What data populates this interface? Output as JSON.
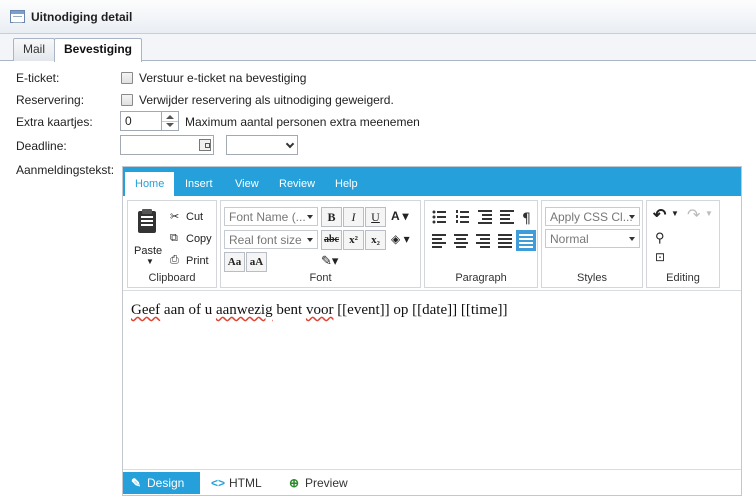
{
  "window": {
    "title": "Uitnodiging detail",
    "icon": "table-icon"
  },
  "tabs": [
    {
      "label": "Mail"
    },
    {
      "label": "Bevestiging"
    }
  ],
  "form": {
    "eticket": {
      "label": "E-ticket:",
      "checkbox_label": "Verstuur e-ticket na bevestiging",
      "checked": false
    },
    "reservering": {
      "label": "Reservering:",
      "checkbox_label": "Verwijder reservering als uitnodiging geweigerd.",
      "checked": false
    },
    "extra": {
      "label": "Extra kaartjes:",
      "value": "0",
      "hint": "Maximum aantal personen extra meenemen"
    },
    "deadline": {
      "label": "Deadline:",
      "date_value": "",
      "time_value": ""
    },
    "aanmelding": {
      "label": "Aanmeldingstekst:"
    }
  },
  "editor": {
    "ribbon_tabs": [
      "Home",
      "Insert",
      "View",
      "Review",
      "Help"
    ],
    "active_tab": "Home",
    "clipboard": {
      "label": "Clipboard",
      "paste": "Paste",
      "cut": "Cut",
      "copy": "Copy",
      "print": "Print"
    },
    "font": {
      "label": "Font",
      "font_name": "Font Name (...",
      "font_size": "Real font size"
    },
    "paragraph": {
      "label": "Paragraph"
    },
    "styles": {
      "label": "Styles",
      "css_class": "Apply CSS Cl...",
      "format": "Normal"
    },
    "editing": {
      "label": "Editing"
    },
    "content": {
      "parts": [
        "Geef",
        " aan of u ",
        "aanwezig",
        " bent ",
        "voor",
        " [[event]] op [[date]] [[time]]"
      ]
    },
    "modes": [
      {
        "label": "Design"
      },
      {
        "label": "HTML"
      },
      {
        "label": "Preview"
      }
    ],
    "accent_color": "#25a0da"
  }
}
